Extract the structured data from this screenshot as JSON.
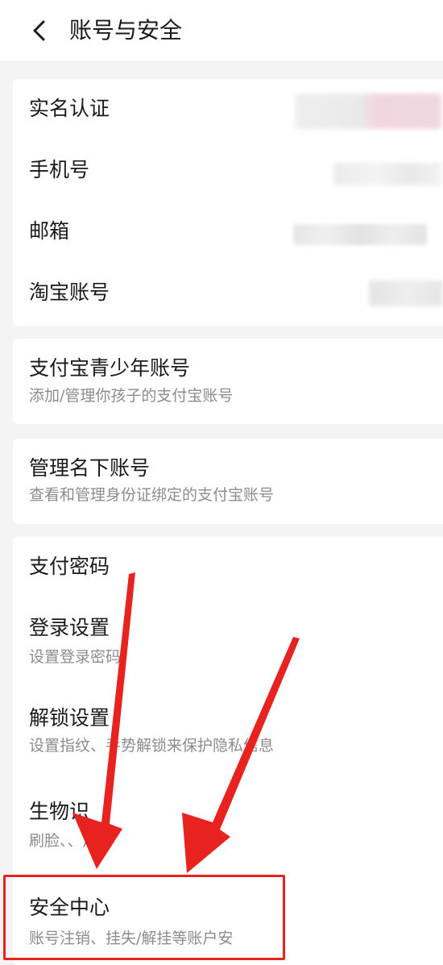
{
  "header": {
    "title": "账号与安全"
  },
  "identity_section": {
    "items": [
      {
        "label": "实名认证"
      },
      {
        "label": "手机号"
      },
      {
        "label": "邮箱"
      },
      {
        "label": "淘宝账号"
      }
    ]
  },
  "teen_account": {
    "label": "支付宝青少年账号",
    "sub": "添加/管理你孩子的支付宝账号"
  },
  "manage_accounts": {
    "label": "管理名下账号",
    "sub": "查看和管理身份证绑定的支付宝账号"
  },
  "security_section": {
    "items": [
      {
        "label": "支付密码",
        "sub": ""
      },
      {
        "label": "登录设置",
        "sub": "设置登录密码"
      },
      {
        "label": "解锁设置",
        "sub": "设置指纹、手势解锁来保护隐私信息"
      },
      {
        "label": "生物识",
        "sub": "刷脸、、声音"
      },
      {
        "label": "安全中心",
        "sub": "账号注销、挂失/解挂等账户安"
      }
    ]
  },
  "colors": {
    "annotation_red": "#e8231f",
    "background": "#f4f4f4",
    "text_primary": "#1a1a1a",
    "text_secondary": "#8c8c8c"
  },
  "icons": {
    "back": "chevron-left-icon"
  }
}
